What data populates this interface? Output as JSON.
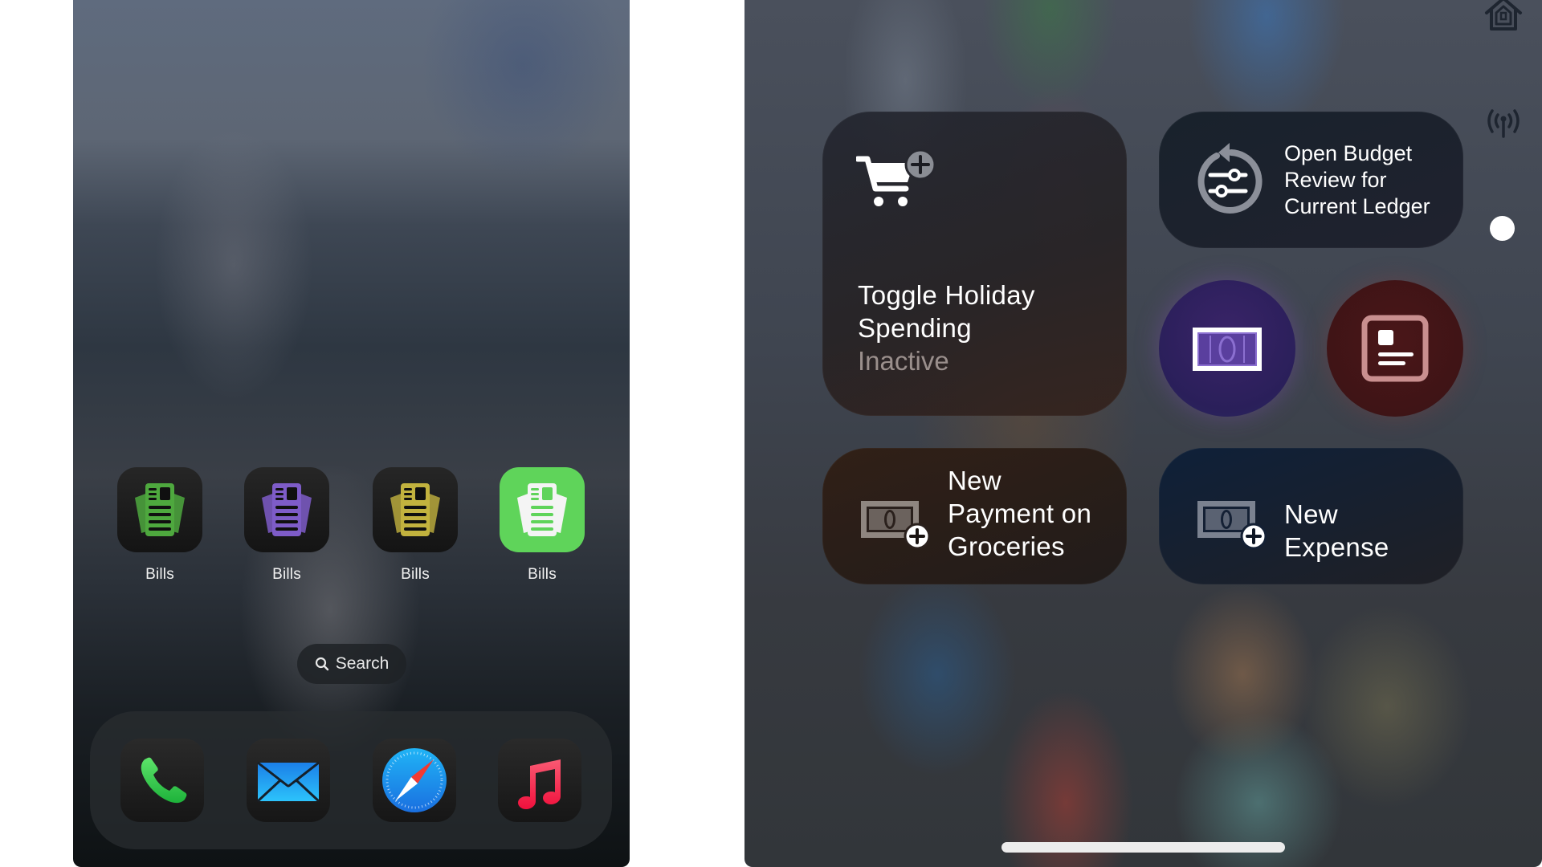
{
  "home_screen": {
    "apps": [
      {
        "label": "Bills",
        "icon": "bills-icon",
        "color": "#4ea83e",
        "variant": "dark"
      },
      {
        "label": "Bills",
        "icon": "bills-icon",
        "color": "#7e5cc8",
        "variant": "dark"
      },
      {
        "label": "Bills",
        "icon": "bills-icon",
        "color": "#c2b23e",
        "variant": "dark"
      },
      {
        "label": "Bills",
        "icon": "bills-icon",
        "color": "#ffffff",
        "variant": "bright",
        "background": "#5fd45a"
      }
    ],
    "search_label": "Search",
    "dock": [
      {
        "name": "Phone",
        "icon": "phone-icon",
        "color": "#34c759"
      },
      {
        "name": "Mail",
        "icon": "mail-icon",
        "color": "#1e9bf0"
      },
      {
        "name": "Safari",
        "icon": "safari-compass-icon",
        "color": "#1f8bf0"
      },
      {
        "name": "Music",
        "icon": "music-note-icon",
        "color": "#fa2d55"
      }
    ]
  },
  "control_center": {
    "tiles": {
      "holiday": {
        "title_line1": "Toggle Holiday",
        "title_line2": "Spending",
        "status": "Inactive",
        "icon": "cart-plus-icon"
      },
      "budget": {
        "line1": "Open Budget",
        "line2": "Review for",
        "line3": "Current Ledger",
        "icon": "sliders-refresh-icon"
      },
      "cash": {
        "icon": "banknote-icon",
        "accent": "#8b6fd0"
      },
      "card": {
        "icon": "id-card-icon",
        "accent": "#c98f8f"
      },
      "payment": {
        "line1": "New",
        "line2": "Payment on",
        "line3": "Groceries",
        "icon": "banknote-plus-icon"
      },
      "expense": {
        "line1": "New",
        "line2": "Expense",
        "icon": "banknote-plus-icon"
      }
    },
    "edge_icons": [
      "home-icon",
      "antenna-icon",
      "page-dot"
    ]
  }
}
